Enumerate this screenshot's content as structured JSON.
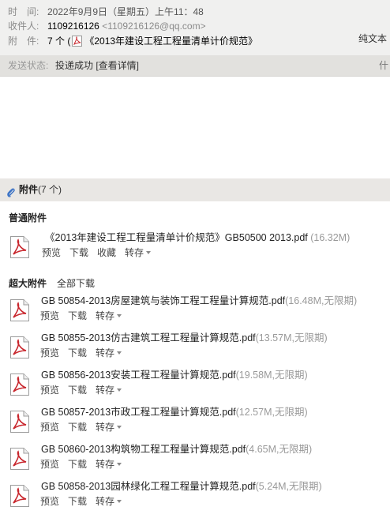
{
  "header": {
    "time_label": "时　间:",
    "time_value": "2022年9月9日（星期五）上午11：48",
    "recipient_label": "收件人:",
    "recipient_name": "1109216126",
    "recipient_email": "<1109216126@qq.com>",
    "attach_label": "附　件:",
    "attach_count": "7 个",
    "attach_paren": "(",
    "attach_first": "《2013年建设工程工程量清单计价规范》",
    "pure_text": "纯文本"
  },
  "status": {
    "label": "发送状态:",
    "value": "投递成功 [查看详情]",
    "more": "什"
  },
  "attachments": {
    "title": "附件",
    "count": "(7 个)",
    "normal_title": "普通附件",
    "super_title": "超大附件",
    "download_all": "全部下载",
    "normal": [
      {
        "name": "《2013年建设工程工程量清单计价规范》GB50500 2013.pdf",
        "size": " (16.32M)",
        "actions": [
          "预览",
          "下载",
          "收藏",
          "转存"
        ]
      }
    ],
    "super": [
      {
        "name": "GB 50854-2013房屋建筑与装饰工程工程量计算规范.pdf",
        "size": "(16.48M,无限期)",
        "actions": [
          "预览",
          "下载",
          "转存"
        ]
      },
      {
        "name": "GB 50855-2013仿古建筑工程工程量计算规范.pdf",
        "size": "(13.57M,无限期)",
        "actions": [
          "预览",
          "下载",
          "转存"
        ]
      },
      {
        "name": "GB 50856-2013安装工程工程量计算规范.pdf",
        "size": "(19.58M,无限期)",
        "actions": [
          "预览",
          "下载",
          "转存"
        ]
      },
      {
        "name": "GB 50857-2013市政工程工程量计算规范.pdf",
        "size": "(12.57M,无限期)",
        "actions": [
          "预览",
          "下载",
          "转存"
        ]
      },
      {
        "name": "GB 50860-2013构筑物工程工程量计算规范.pdf",
        "size": "(4.65M,无限期)",
        "actions": [
          "预览",
          "下载",
          "转存"
        ]
      },
      {
        "name": "GB 50858-2013园林绿化工程工程量计算规范.pdf",
        "size": "(5.24M,无限期)",
        "actions": [
          "预览",
          "下载",
          "转存"
        ]
      }
    ]
  },
  "colors": {
    "header_bg": "#f0f0ef",
    "status_bg": "#e2e1de",
    "attach_head_bg": "#e9e7e4",
    "pdf_red": "#c8252c",
    "clip_blue": "#3b73c6"
  },
  "icons": {
    "pdf": "pdf-file-icon",
    "clip": "paperclip-icon"
  }
}
